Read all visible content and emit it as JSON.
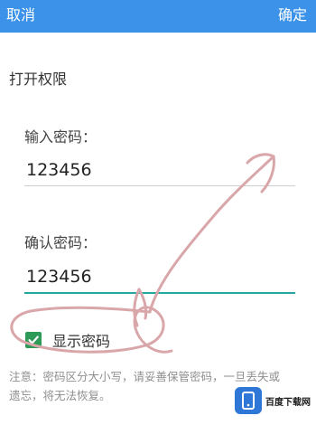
{
  "header": {
    "cancel_label": "取消",
    "confirm_label": "确定",
    "bar_color": "#3b92e8"
  },
  "page": {
    "title": "打开权限"
  },
  "password": {
    "label": "输入密码：",
    "value": "123456"
  },
  "confirm_password": {
    "label": "确认密码：",
    "value": "123456",
    "focus_color": "#24a89d"
  },
  "show_password": {
    "label": "显示密码",
    "checked": true,
    "checkbox_color": "#2e9a57"
  },
  "note": "注意：密码区分大小写，请妥善保管密码，一旦丢失或遗忘，将无法恢复。",
  "watermark": {
    "text": "百度下载网",
    "icon": "phone-app-icon"
  },
  "annotation": {
    "icon": "hand-drawn-arrow-scribble",
    "color": "#d9a6aa"
  }
}
